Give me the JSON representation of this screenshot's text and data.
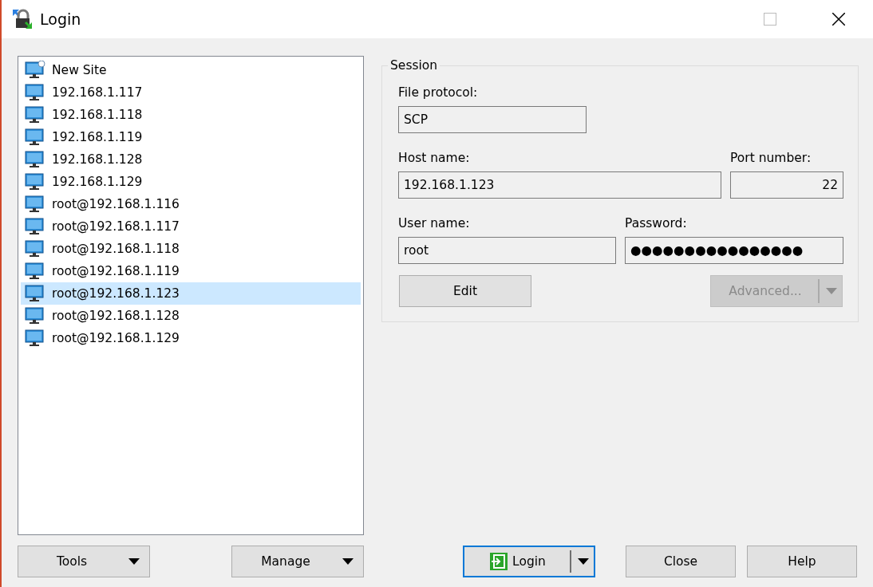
{
  "window": {
    "title": "Login"
  },
  "sites": [
    {
      "label": "New Site",
      "kind": "new",
      "selected": false
    },
    {
      "label": "192.168.1.117",
      "kind": "site",
      "selected": false
    },
    {
      "label": "192.168.1.118",
      "kind": "site",
      "selected": false
    },
    {
      "label": "192.168.1.119",
      "kind": "site",
      "selected": false
    },
    {
      "label": "192.168.1.128",
      "kind": "site",
      "selected": false
    },
    {
      "label": "192.168.1.129",
      "kind": "site",
      "selected": false
    },
    {
      "label": "root@192.168.1.116",
      "kind": "site",
      "selected": false
    },
    {
      "label": "root@192.168.1.117",
      "kind": "site",
      "selected": false
    },
    {
      "label": "root@192.168.1.118",
      "kind": "site",
      "selected": false
    },
    {
      "label": "root@192.168.1.119",
      "kind": "site",
      "selected": false
    },
    {
      "label": "root@192.168.1.123",
      "kind": "site",
      "selected": true
    },
    {
      "label": "root@192.168.1.128",
      "kind": "site",
      "selected": false
    },
    {
      "label": "root@192.168.1.129",
      "kind": "site",
      "selected": false
    }
  ],
  "session": {
    "title": "Session",
    "file_protocol": {
      "label": "File protocol:",
      "value": "SCP"
    },
    "host_name": {
      "label": "Host name:",
      "value": "192.168.1.123"
    },
    "port_number": {
      "label": "Port number:",
      "value": "22"
    },
    "user_name": {
      "label": "User name:",
      "value": "root"
    },
    "password": {
      "label": "Password:",
      "value": "●●●●●●●●●●●●●●●●"
    },
    "edit_button": {
      "label": "Edit",
      "disabled": false
    },
    "advanced_button": {
      "label": "Advanced...",
      "disabled": true
    }
  },
  "left_buttons": [
    {
      "label": "Tools"
    },
    {
      "label": "Manage"
    }
  ],
  "right_buttons": [
    {
      "label": "Login",
      "kind": "split",
      "default": true
    },
    {
      "label": "Close",
      "kind": "plain",
      "default": false
    },
    {
      "label": "Help",
      "kind": "plain",
      "default": false
    }
  ]
}
